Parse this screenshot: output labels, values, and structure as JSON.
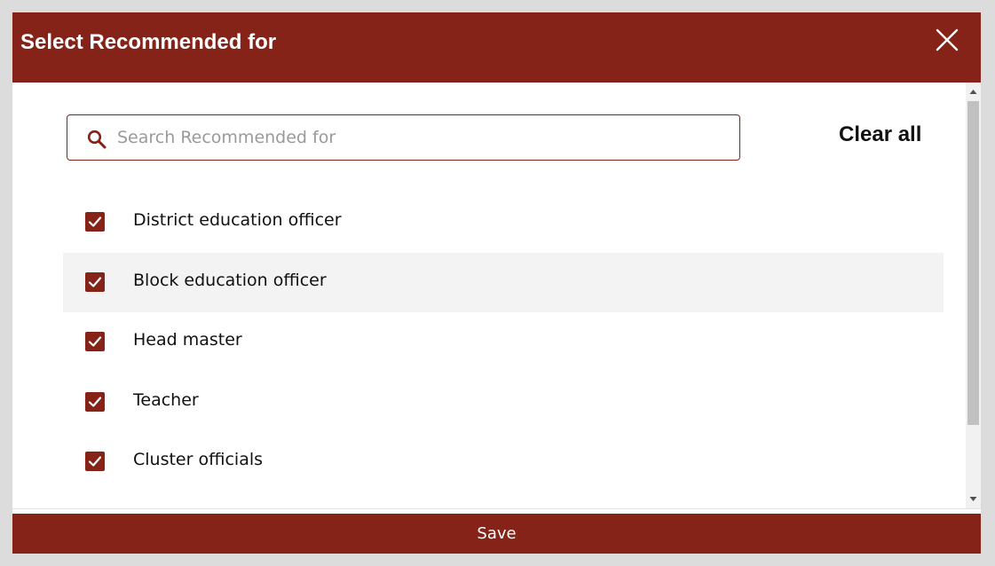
{
  "dialog": {
    "title": "Select Recommended for",
    "close_icon": "close-icon"
  },
  "search": {
    "placeholder": "Search Recommended for",
    "value": "",
    "icon": "search-icon"
  },
  "clear_all_label": "Clear all",
  "options": [
    {
      "label": "District education officer",
      "checked": true
    },
    {
      "label": "Block education officer",
      "checked": true,
      "hovered": true
    },
    {
      "label": "Head master",
      "checked": true
    },
    {
      "label": "Teacher",
      "checked": true
    },
    {
      "label": "Cluster officials",
      "checked": true
    }
  ],
  "save_label": "Save",
  "colors": {
    "accent": "#862318",
    "hover_row": "#f3f3f3"
  }
}
